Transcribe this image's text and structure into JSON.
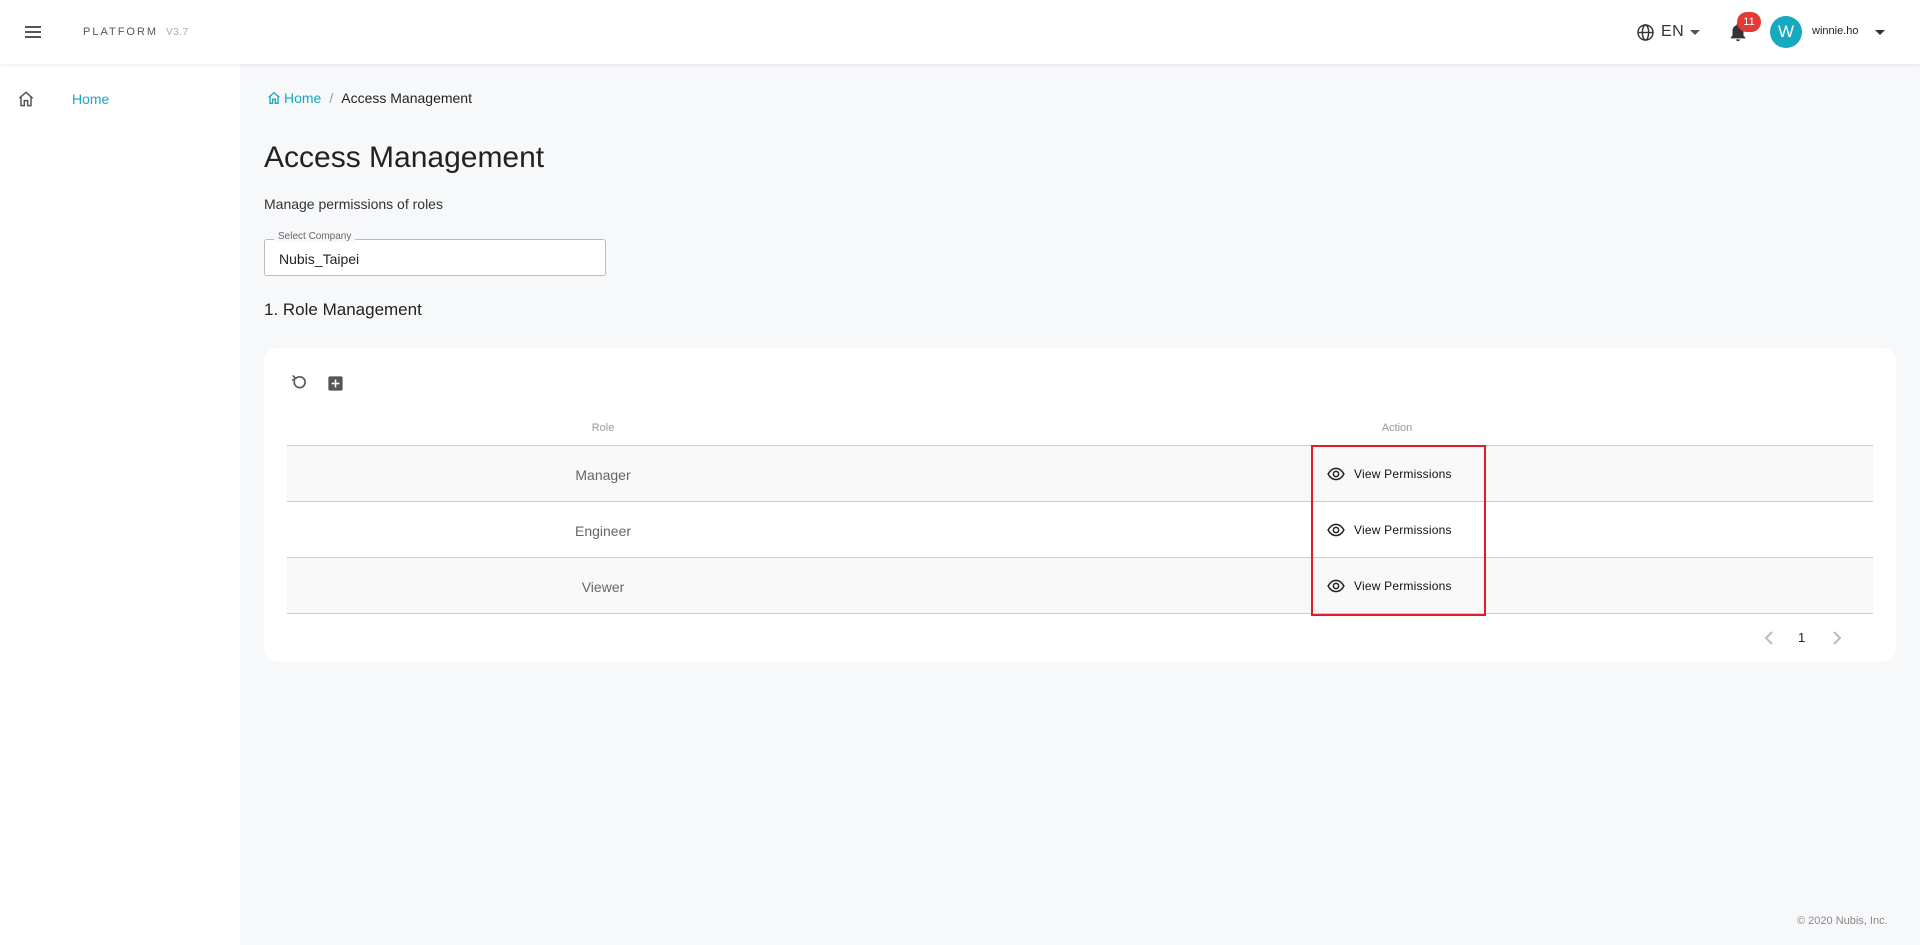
{
  "header": {
    "brand": "PLATFORM",
    "version": "V3.7",
    "language": "EN",
    "notification_count": "11",
    "avatar_initial": "W",
    "username": "winnie.ho"
  },
  "sidebar": {
    "items": [
      {
        "label": "Home",
        "icon": "home-icon"
      }
    ]
  },
  "breadcrumb": {
    "home": "Home",
    "separator": "/",
    "current": "Access Management"
  },
  "page": {
    "title": "Access Management",
    "subtitle": "Manage permissions of roles"
  },
  "company_select": {
    "label": "Select Company",
    "value": "Nubis_Taipei"
  },
  "section": {
    "title": "1. Role Management"
  },
  "toolbar": {
    "refresh_icon": "refresh-icon",
    "add_icon": "add-box-icon"
  },
  "table": {
    "columns": [
      "Role",
      "Action"
    ],
    "rows": [
      {
        "role": "Manager",
        "action": "View Permissions"
      },
      {
        "role": "Engineer",
        "action": "View Permissions"
      },
      {
        "role": "Viewer",
        "action": "View Permissions"
      }
    ]
  },
  "pagination": {
    "current_page": "1"
  },
  "footer": {
    "copyright": "© 2020 Nubis, Inc."
  },
  "colors": {
    "accent": "#16a9bf",
    "badge": "#e53935",
    "highlight": "#e01b2a"
  }
}
